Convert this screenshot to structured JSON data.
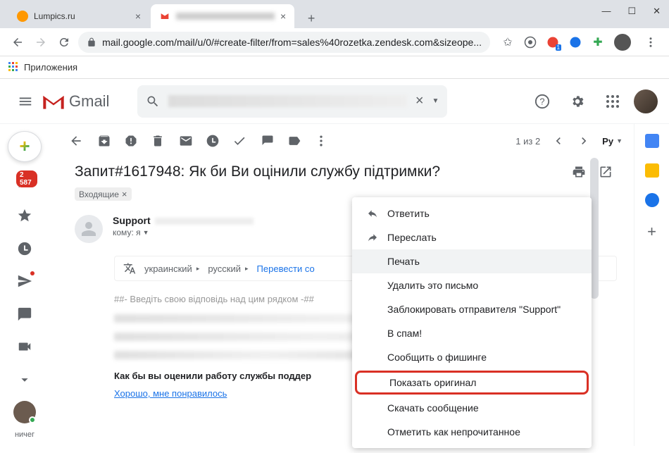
{
  "window_controls": {
    "min": "—",
    "max": "☐",
    "close": "✕"
  },
  "tabs": [
    {
      "title": "Lumpics.ru",
      "active": false
    },
    {
      "title": "",
      "active": true
    }
  ],
  "url": "mail.google.com/mail/u/0/#create-filter/from=sales%40rozetka.zendesk.com&sizeope...",
  "bookmarks_bar": {
    "apps": "Приложения"
  },
  "gmail": {
    "brand": "Gmail"
  },
  "search": {
    "placeholder": ""
  },
  "toolbar": {
    "counter": "1 из 2",
    "lang": "Ру"
  },
  "email": {
    "subject": "Запит#1617948: Як би Ви оцінили службу підтримки?",
    "inbox_chip": "Входящие",
    "sender": "Support",
    "to_label": "кому: я",
    "translate": {
      "from": "украинский",
      "to": "русский",
      "action": "Перевести со"
    },
    "body_marker": "##- Введіть свою відповідь над цим рядком -##",
    "body_question": "Как бы вы оценили работу службы поддер",
    "body_link": "Хорошо, мне понравилось"
  },
  "context_menu": {
    "reply": "Ответить",
    "forward": "Переслать",
    "print": "Печать",
    "delete": "Удалить это письмо",
    "block": "Заблокировать отправителя \"Support\"",
    "spam": "В спам!",
    "phishing": "Сообщить о фишинге",
    "show_original": "Показать оригинал",
    "download": "Скачать сообщение",
    "mark_unread": "Отметить как непрочитанное"
  },
  "sidebar": {
    "inbox_badge": "2 587",
    "bottom_text": "ничег"
  }
}
